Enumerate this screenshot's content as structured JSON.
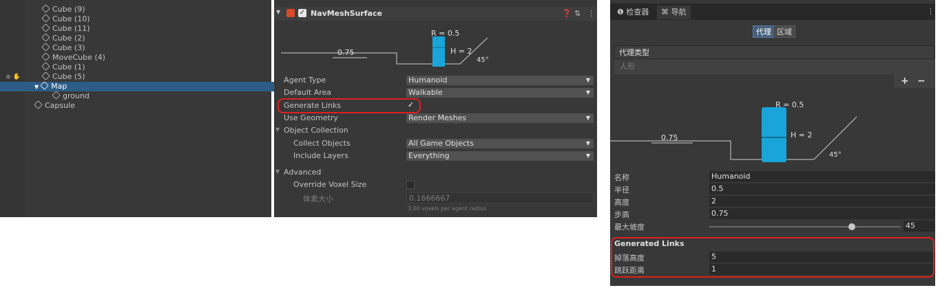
{
  "hierarchy": {
    "items": [
      "Cube (9)",
      "Cube (10)",
      "Cube (11)",
      "Cube (2)",
      "Cube (3)",
      "MoveCube (4)",
      "Cube (1)",
      "Cube (5)"
    ],
    "map": "Map",
    "ground": "ground",
    "capsule": "Capsule"
  },
  "inspector": {
    "component_title": "NavMeshSurface",
    "diagram": {
      "radius_label": "R = 0.5",
      "height_label": "H = 2",
      "step_label": "0.75",
      "slope_label": "45°"
    },
    "fields": {
      "agent_type_label": "Agent Type",
      "agent_type_value": "Humanoid",
      "default_area_label": "Default Area",
      "default_area_value": "Walkable",
      "generate_links_label": "Generate Links",
      "generate_links_value": "✓",
      "use_geometry_label": "Use Geometry",
      "use_geometry_value": "Render Meshes",
      "object_collection_label": "Object Collection",
      "collect_objects_label": "Collect Objects",
      "collect_objects_value": "All Game Objects",
      "include_layers_label": "Include Layers",
      "include_layers_value": "Everything",
      "advanced_label": "Advanced",
      "override_voxel_label": "Override Voxel Size",
      "voxel_size_label": "体素大小",
      "voxel_size_value": "0.1666667",
      "voxel_hint": "3.00 voxels per agent radius"
    }
  },
  "navigation": {
    "tabs": {
      "inspector": "检查器",
      "navigation": "导航"
    },
    "toggle": {
      "agents": "代理",
      "areas": "区域"
    },
    "agent_types_header": "代理类型",
    "agent_list_item": "人形",
    "add_label": "+",
    "remove_label": "−",
    "diagram": {
      "radius_label": "R = 0.5",
      "height_label": "H = 2",
      "step_label": "0.75",
      "slope_label": "45°"
    },
    "fields": {
      "name_label": "名称",
      "name_value": "Humanoid",
      "radius_label": "半径",
      "radius_value": "0.5",
      "height_label": "高度",
      "height_value": "2",
      "step_label": "步高",
      "step_value": "0.75",
      "max_slope_label": "最大坡度",
      "max_slope_value": "45"
    },
    "generated_links": {
      "title": "Generated Links",
      "drop_height_label": "掉落高度",
      "drop_height_value": "5",
      "jump_distance_label": "跳跃距离",
      "jump_distance_value": "1"
    }
  },
  "colors": {
    "panel": "#383838",
    "selected": "#2c5d87",
    "accent_cyan": "#19a5d9",
    "highlight_red": "#e02020"
  }
}
